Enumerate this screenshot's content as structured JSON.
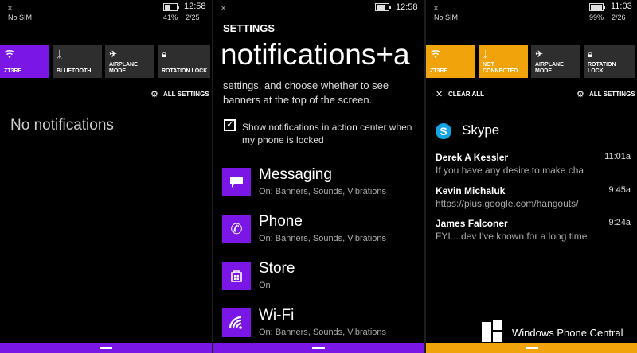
{
  "colors": {
    "purple_accent": "#7a16e6",
    "orange_accent": "#f0a30a",
    "tile_off": "#2e2e2e",
    "skype_blue": "#12a5e6"
  },
  "panel1": {
    "status": {
      "carrier": "No SIM",
      "battery": "41%",
      "time": "12:58",
      "date": "2/25"
    },
    "quick_actions": [
      {
        "label": "ZT3RF",
        "icon": "wifi-icon",
        "active": true
      },
      {
        "label": "BLUETOOTH",
        "icon": "bluetooth-icon",
        "active": false
      },
      {
        "label": "AIRPLANE MODE",
        "icon": "airplane-icon",
        "active": false
      },
      {
        "label": "ROTATION LOCK",
        "icon": "rotation-lock-icon",
        "active": false
      }
    ],
    "all_settings": "ALL SETTINGS",
    "empty_message": "No notifications"
  },
  "panel2": {
    "status": {
      "time": "12:58"
    },
    "header": "SETTINGS",
    "title": "notifications+a",
    "description": "settings, and choose whether to see banners at the top of the screen.",
    "checkbox": {
      "label": "Show notifications in action center when my phone is locked",
      "checked": true
    },
    "apps": [
      {
        "name": "Messaging",
        "detail": "On: Banners, Sounds, Vibrations",
        "icon": "message-icon"
      },
      {
        "name": "Phone",
        "detail": "On: Banners, Sounds, Vibrations",
        "icon": "phone-icon"
      },
      {
        "name": "Store",
        "detail": "On",
        "icon": "store-icon"
      },
      {
        "name": "Wi-Fi",
        "detail": "On: Banners, Sounds, Vibrations",
        "icon": "wifi-icon"
      }
    ]
  },
  "panel3": {
    "status": {
      "carrier": "No SIM",
      "battery": "99%",
      "time": "11:03",
      "date": "2/26"
    },
    "quick_actions": [
      {
        "label": "ZT3RF",
        "icon": "wifi-icon",
        "active": true
      },
      {
        "label": "NOT CONNECTED",
        "icon": "bluetooth-icon",
        "active": true
      },
      {
        "label": "AIRPLANE MODE",
        "icon": "airplane-icon",
        "active": false
      },
      {
        "label": "ROTATION LOCK",
        "icon": "rotation-lock-icon",
        "active": false
      }
    ],
    "clear_all": "CLEAR ALL",
    "all_settings": "ALL SETTINGS",
    "app": "Skype",
    "messages": [
      {
        "sender": "Derek A Kessler",
        "time": "11:01a",
        "text": "If you have any desire to make cha"
      },
      {
        "sender": "Kevin Michaluk",
        "time": "9:45a",
        "text": "https://plus.google.com/hangouts/"
      },
      {
        "sender": "James Falconer",
        "time": "9:24a",
        "text": "FYI... dev I've known for a long time"
      }
    ]
  },
  "watermark": "Windows Phone Central"
}
